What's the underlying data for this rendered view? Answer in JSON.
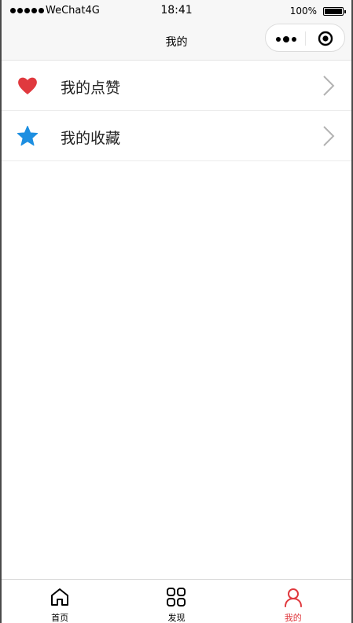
{
  "status_bar": {
    "carrier": "WeChat4G",
    "time": "18:41",
    "battery": "100%"
  },
  "nav_bar": {
    "title": "我的"
  },
  "menu": {
    "items": [
      {
        "label": "我的点赞",
        "icon": "heart-icon",
        "icon_color": "#e0393e"
      },
      {
        "label": "我的收藏",
        "icon": "star-icon",
        "icon_color": "#1d8fe1"
      }
    ]
  },
  "tab_bar": {
    "active_color": "#e0393e",
    "tabs": [
      {
        "label": "首页",
        "icon": "home-icon"
      },
      {
        "label": "发现",
        "icon": "grid-icon"
      },
      {
        "label": "我的",
        "icon": "user-icon",
        "active": true
      }
    ]
  }
}
